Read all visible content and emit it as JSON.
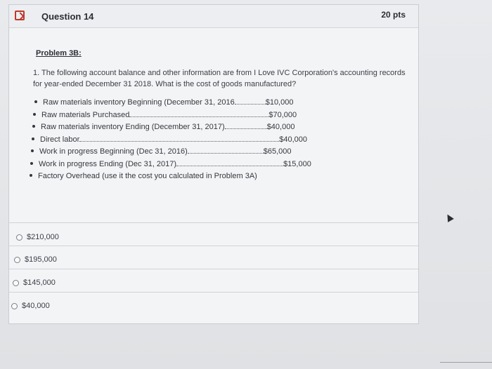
{
  "question": {
    "title": "Question 14",
    "points": "20 pts"
  },
  "problem": {
    "label": "Problem 3B:",
    "prompt": "1. The following account balance and other information are from I Love IVC Corporation's accounting records for year-ended December 31 2018. What is the cost of goods manufactured?",
    "items": [
      {
        "label": "Raw materials inventory Beginning (December 31, 2016",
        "amount": "$10,000"
      },
      {
        "label": "Raw materials Purchased",
        "amount": "$70,000"
      },
      {
        "label": "Raw materials inventory Ending (December 31, 2017)",
        "amount": "$40,000"
      },
      {
        "label": "Direct labor",
        "amount": "$40,000"
      },
      {
        "label": "Work in progress Beginning (Dec 31, 2016)",
        "amount": "$65,000"
      },
      {
        "label": "Work in progress Ending (Dec 31, 2017)",
        "amount": "$15,000"
      },
      {
        "label": "Factory Overhead (use it the cost you calculated in Problem 3A)",
        "amount": ""
      }
    ]
  },
  "answers": [
    {
      "label": "$210,000"
    },
    {
      "label": "$195,000"
    },
    {
      "label": "$145,000"
    },
    {
      "label": "$40,000"
    }
  ],
  "icons": {
    "flag": "flag-icon",
    "cursor": "cursor-icon"
  },
  "colors": {
    "flag": "#c0392b",
    "card_bg": "#f3f4f6"
  }
}
